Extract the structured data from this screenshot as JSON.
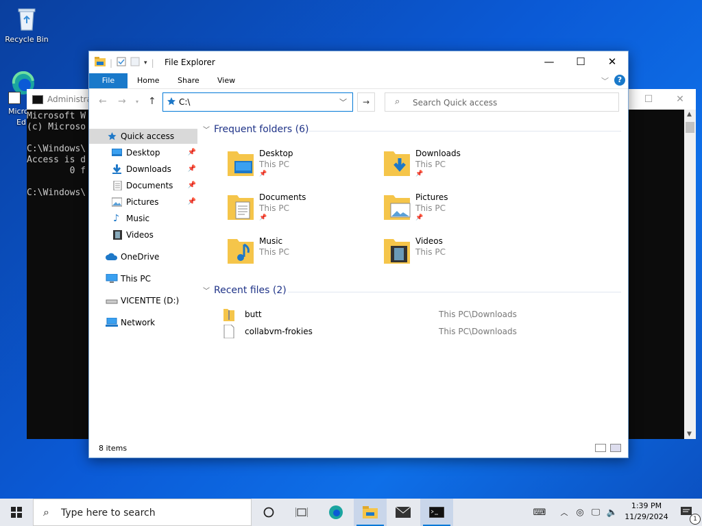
{
  "desktop": {
    "recycle_bin_label": "Recycle Bin",
    "edge_label_line1": "Micro",
    "edge_label_line2": "Ed"
  },
  "console": {
    "title": "Administra",
    "lines": [
      "Microsoft W",
      "(c) Microso",
      "",
      "C:\\Windows\\",
      "Access is d",
      "        0 f",
      "",
      "C:\\Windows\\"
    ]
  },
  "explorer": {
    "title": "File Explorer",
    "ribbon_tabs": {
      "file": "File",
      "home": "Home",
      "share": "Share",
      "view": "View"
    },
    "help_label": "?",
    "address_value": "C:\\",
    "search_placeholder": "Search Quick access",
    "sidebar": {
      "quick_access": "Quick access",
      "desktop": "Desktop",
      "downloads": "Downloads",
      "documents": "Documents",
      "pictures": "Pictures",
      "music": "Music",
      "videos": "Videos",
      "onedrive": "OneDrive",
      "this_pc": "This PC",
      "drive": "VICENTTE (D:)",
      "network": "Network"
    },
    "frequent_header": "Frequent folders (6)",
    "frequent": [
      {
        "name": "Desktop",
        "location": "This PC",
        "pinned": true,
        "icon": "desktop-folder-icon"
      },
      {
        "name": "Downloads",
        "location": "This PC",
        "pinned": true,
        "icon": "downloads-folder-icon"
      },
      {
        "name": "Documents",
        "location": "This PC",
        "pinned": true,
        "icon": "documents-folder-icon"
      },
      {
        "name": "Pictures",
        "location": "This PC",
        "pinned": true,
        "icon": "pictures-folder-icon"
      },
      {
        "name": "Music",
        "location": "This PC",
        "pinned": false,
        "icon": "music-folder-icon"
      },
      {
        "name": "Videos",
        "location": "This PC",
        "pinned": false,
        "icon": "videos-folder-icon"
      }
    ],
    "recent_header": "Recent files (2)",
    "recent": [
      {
        "name": "butt",
        "path": "This PC\\Downloads",
        "icon": "zip-file-icon"
      },
      {
        "name": "collabvm-frokies",
        "path": "This PC\\Downloads",
        "icon": "blank-file-icon"
      }
    ],
    "status_count": "8 items"
  },
  "taskbar": {
    "search_placeholder": "Type here to search",
    "time": "1:39 PM",
    "date": "11/29/2024",
    "notification_count": "1"
  },
  "colors": {
    "accent": "#0078d7",
    "ribbon_file_tab": "#1979ca",
    "section_header": "#1e3287"
  }
}
